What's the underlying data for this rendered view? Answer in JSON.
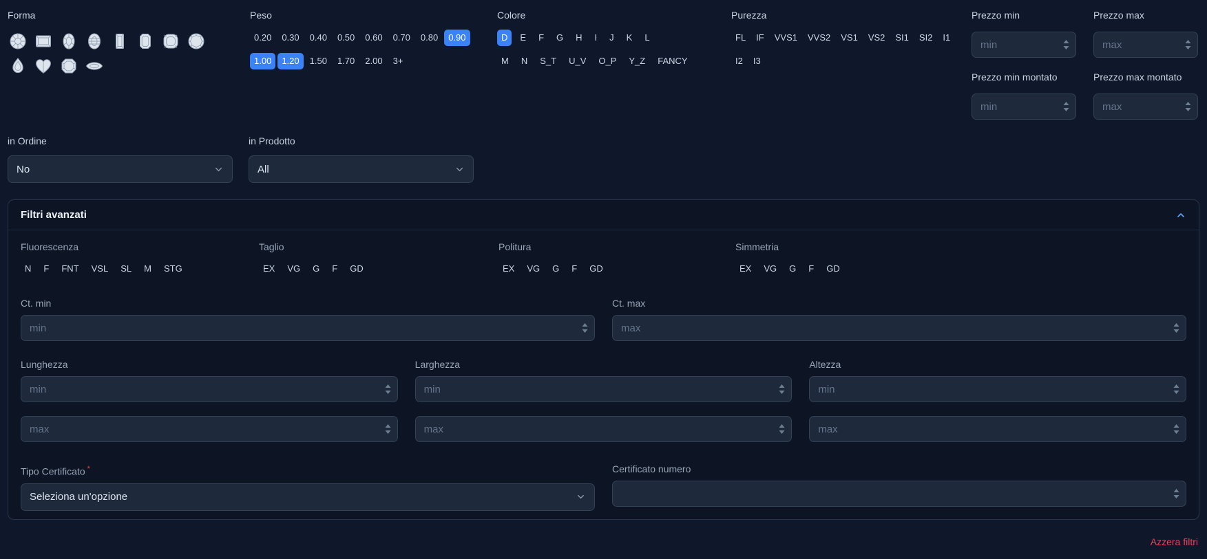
{
  "colors": {
    "accent": "#3b82f6",
    "danger": "#f43f5e",
    "background": "#0f172a"
  },
  "forma": {
    "label": "Forma",
    "shapes": [
      "round",
      "princess",
      "oval",
      "oval-2",
      "baguette",
      "emerald",
      "cushion",
      "round-brilliant",
      "pear",
      "heart",
      "asscher",
      "marquise"
    ]
  },
  "peso": {
    "label": "Peso",
    "options": [
      {
        "label": "0.20",
        "selected": false
      },
      {
        "label": "0.30",
        "selected": false
      },
      {
        "label": "0.40",
        "selected": false
      },
      {
        "label": "0.50",
        "selected": false
      },
      {
        "label": "0.60",
        "selected": false
      },
      {
        "label": "0.70",
        "selected": false
      },
      {
        "label": "0.80",
        "selected": false
      },
      {
        "label": "0.90",
        "selected": true
      },
      {
        "label": "1.00",
        "selected": true
      },
      {
        "label": "1.20",
        "selected": true
      },
      {
        "label": "1.50",
        "selected": false
      },
      {
        "label": "1.70",
        "selected": false
      },
      {
        "label": "2.00",
        "selected": false
      },
      {
        "label": "3+",
        "selected": false
      }
    ]
  },
  "colore": {
    "label": "Colore",
    "options": [
      {
        "label": "D",
        "selected": true
      },
      {
        "label": "E",
        "selected": false
      },
      {
        "label": "F",
        "selected": false
      },
      {
        "label": "G",
        "selected": false
      },
      {
        "label": "H",
        "selected": false
      },
      {
        "label": "I",
        "selected": false
      },
      {
        "label": "J",
        "selected": false
      },
      {
        "label": "K",
        "selected": false
      },
      {
        "label": "L",
        "selected": false
      },
      {
        "label": "M",
        "selected": false
      },
      {
        "label": "N",
        "selected": false
      },
      {
        "label": "S_T",
        "selected": false
      },
      {
        "label": "U_V",
        "selected": false
      },
      {
        "label": "O_P",
        "selected": false
      },
      {
        "label": "Y_Z",
        "selected": false
      },
      {
        "label": "FANCY",
        "selected": false
      }
    ]
  },
  "purezza": {
    "label": "Purezza",
    "options": [
      {
        "label": "FL",
        "selected": false
      },
      {
        "label": "IF",
        "selected": false
      },
      {
        "label": "VVS1",
        "selected": false
      },
      {
        "label": "VVS2",
        "selected": false
      },
      {
        "label": "VS1",
        "selected": false
      },
      {
        "label": "VS2",
        "selected": false
      },
      {
        "label": "SI1",
        "selected": false
      },
      {
        "label": "SI2",
        "selected": false
      },
      {
        "label": "I1",
        "selected": false
      },
      {
        "label": "I2",
        "selected": false
      },
      {
        "label": "I3",
        "selected": false
      }
    ]
  },
  "prezzo": {
    "min": {
      "label": "Prezzo min",
      "placeholder": "min"
    },
    "max": {
      "label": "Prezzo max",
      "placeholder": "max"
    },
    "min_montato": {
      "label": "Prezzo min montato",
      "placeholder": "min"
    },
    "max_montato": {
      "label": "Prezzo max montato",
      "placeholder": "max"
    }
  },
  "in_ordine": {
    "label": "in Ordine",
    "value": "No"
  },
  "in_prodotto": {
    "label": "in Prodotto",
    "value": "All"
  },
  "advanced": {
    "title": "Filtri avanzati",
    "fluorescenza": {
      "label": "Fluorescenza",
      "options": [
        "N",
        "F",
        "FNT",
        "VSL",
        "SL",
        "M",
        "STG"
      ]
    },
    "taglio": {
      "label": "Taglio",
      "options": [
        "EX",
        "VG",
        "G",
        "F",
        "GD"
      ]
    },
    "politura": {
      "label": "Politura",
      "options": [
        "EX",
        "VG",
        "G",
        "F",
        "GD"
      ]
    },
    "simmetria": {
      "label": "Simmetria",
      "options": [
        "EX",
        "VG",
        "G",
        "F",
        "GD"
      ]
    },
    "ct_min": {
      "label": "Ct. min",
      "placeholder": "min"
    },
    "ct_max": {
      "label": "Ct. max",
      "placeholder": "max"
    },
    "lunghezza": {
      "label": "Lunghezza",
      "min_placeholder": "min",
      "max_placeholder": "max"
    },
    "larghezza": {
      "label": "Larghezza",
      "min_placeholder": "min",
      "max_placeholder": "max"
    },
    "altezza": {
      "label": "Altezza",
      "min_placeholder": "min",
      "max_placeholder": "max"
    },
    "tipo_certificato": {
      "label": "Tipo Certificato",
      "required_mark": "*",
      "value": "Seleziona un'opzione"
    },
    "certificato_numero": {
      "label": "Certificato numero",
      "value": ""
    }
  },
  "footer": {
    "reset_label": "Azzera filtri"
  }
}
